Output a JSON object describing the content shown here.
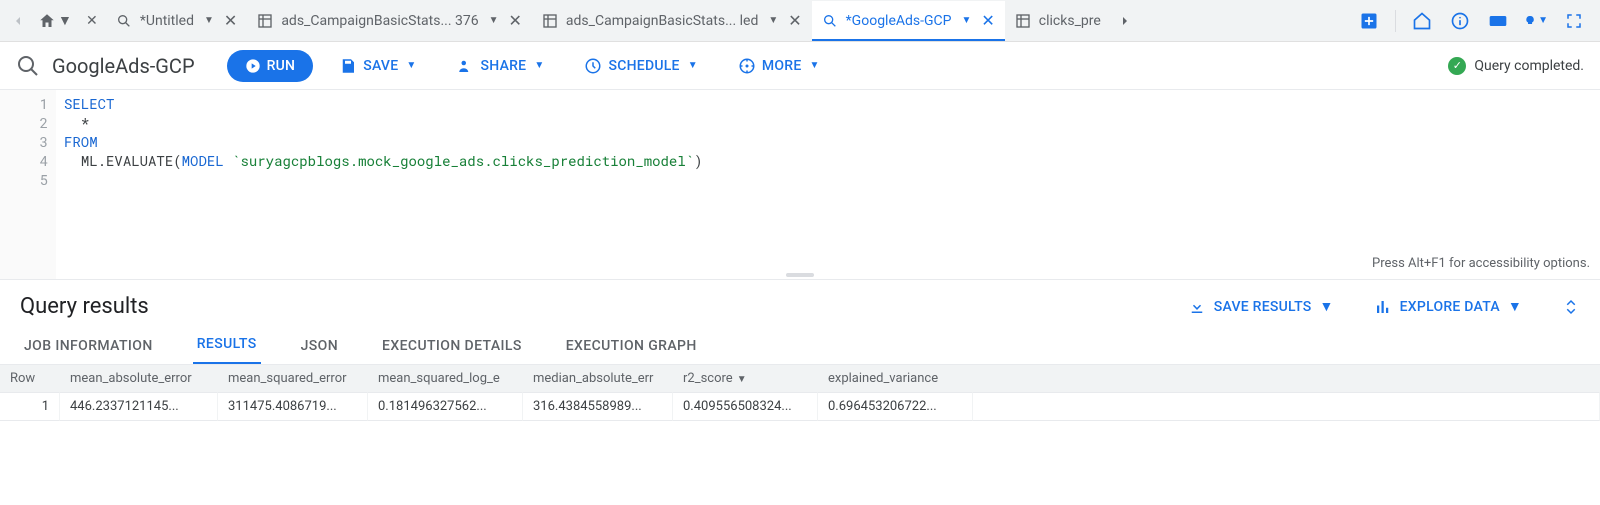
{
  "tabs": {
    "items": [
      {
        "type": "untitled",
        "label": "*Untitled"
      },
      {
        "type": "table",
        "label": "ads_CampaignBasicStats... 376"
      },
      {
        "type": "table",
        "label": "ads_CampaignBasicStats... led"
      },
      {
        "type": "query",
        "label": "*GoogleAds-GCP",
        "active": true
      },
      {
        "type": "table-short",
        "label": "clicks_pre"
      }
    ]
  },
  "toolbar": {
    "title": "GoogleAds-GCP",
    "run_label": "RUN",
    "save_label": "SAVE",
    "share_label": "SHARE",
    "schedule_label": "SCHEDULE",
    "more_label": "MORE",
    "status_text": "Query completed."
  },
  "editor": {
    "lines": [
      "1",
      "2",
      "3",
      "4",
      "5"
    ],
    "hint": "Press Alt+F1 for accessibility options.",
    "select_kw": "SELECT",
    "star": "*",
    "from_kw": "FROM",
    "fn": "ML.EVALUATE",
    "model_kw": "MODEL",
    "model_ref": "`suryagcpblogs.mock_google_ads.clicks_prediction_model`"
  },
  "results": {
    "title": "Query results",
    "save_results_label": "SAVE RESULTS",
    "explore_data_label": "EXPLORE DATA",
    "subtabs": {
      "job_info": "JOB INFORMATION",
      "results": "RESULTS",
      "json": "JSON",
      "exec_details": "EXECUTION DETAILS",
      "exec_graph": "EXECUTION GRAPH"
    },
    "columns": {
      "row": "Row",
      "c0": "mean_absolute_error",
      "c1": "mean_squared_error",
      "c2": "mean_squared_log_e",
      "c3": "median_absolute_err",
      "c4": "r2_score",
      "c5": "explained_variance"
    },
    "row": {
      "idx": "1",
      "v0": "446.2337121145...",
      "v1": "311475.4086719...",
      "v2": "0.181496327562...",
      "v3": "316.4384558989...",
      "v4": "0.409556508324...",
      "v5": "0.696453206722..."
    }
  }
}
